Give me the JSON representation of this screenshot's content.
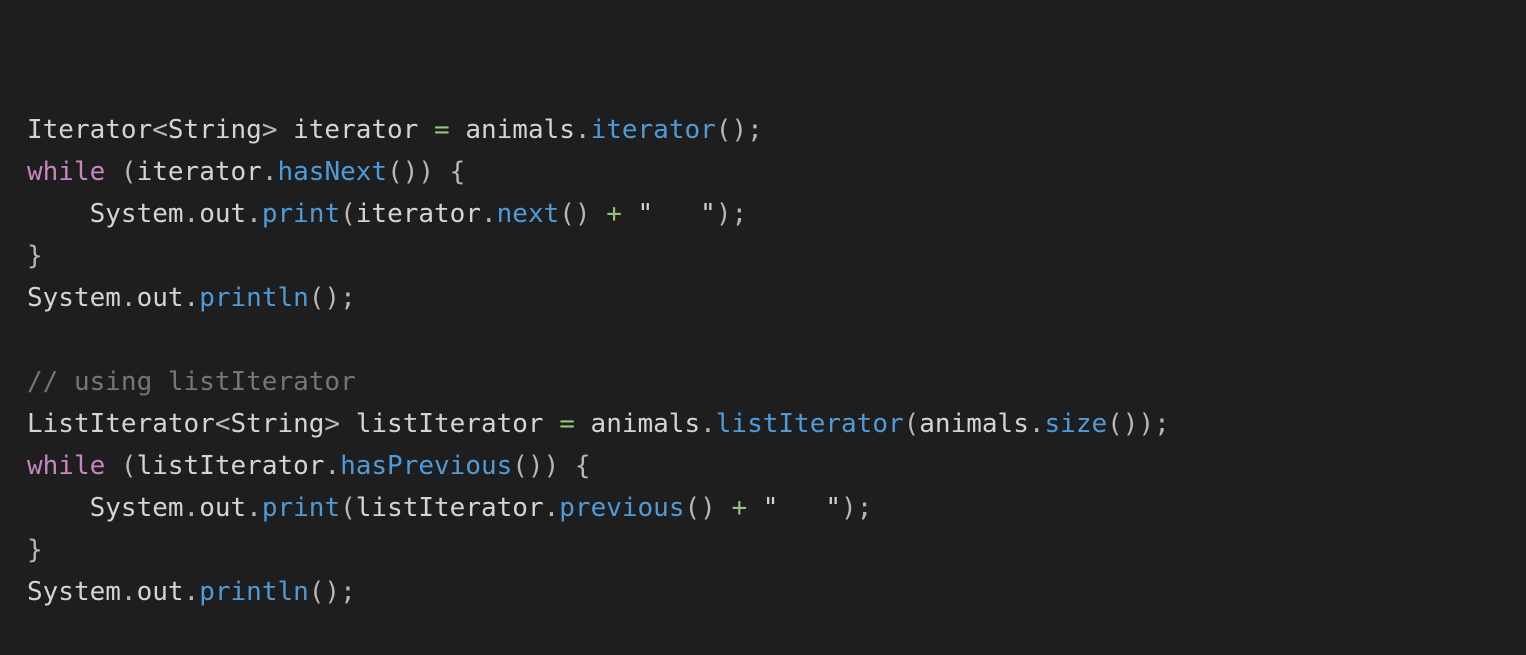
{
  "colors": {
    "background": "#1e1e1e",
    "text": "#d4d4d4",
    "keyword": "#c586c0",
    "function": "#4d9bd8",
    "operator": "#98c379",
    "comment": "#767676"
  },
  "code": {
    "lines": [
      {
        "tokens": [
          {
            "text": "Iterator",
            "type": "plain"
          },
          {
            "text": "<",
            "type": "punc"
          },
          {
            "text": "String",
            "type": "plain"
          },
          {
            "text": ">",
            "type": "punc"
          },
          {
            "text": " iterator ",
            "type": "plain"
          },
          {
            "text": "=",
            "type": "op"
          },
          {
            "text": " animals",
            "type": "plain"
          },
          {
            "text": ".",
            "type": "punc"
          },
          {
            "text": "iterator",
            "type": "fn"
          },
          {
            "text": "();",
            "type": "punc"
          }
        ]
      },
      {
        "tokens": [
          {
            "text": "while",
            "type": "kw"
          },
          {
            "text": " (",
            "type": "punc"
          },
          {
            "text": "iterator",
            "type": "plain"
          },
          {
            "text": ".",
            "type": "punc"
          },
          {
            "text": "hasNext",
            "type": "fn"
          },
          {
            "text": "()) {",
            "type": "punc"
          }
        ]
      },
      {
        "tokens": [
          {
            "text": "    System",
            "type": "plain"
          },
          {
            "text": ".",
            "type": "punc"
          },
          {
            "text": "out",
            "type": "plain"
          },
          {
            "text": ".",
            "type": "punc"
          },
          {
            "text": "print",
            "type": "fn"
          },
          {
            "text": "(",
            "type": "punc"
          },
          {
            "text": "iterator",
            "type": "plain"
          },
          {
            "text": ".",
            "type": "punc"
          },
          {
            "text": "next",
            "type": "fn"
          },
          {
            "text": "() ",
            "type": "punc"
          },
          {
            "text": "+",
            "type": "op"
          },
          {
            "text": " \"   \"",
            "type": "str"
          },
          {
            "text": ");",
            "type": "punc"
          }
        ]
      },
      {
        "tokens": [
          {
            "text": "}",
            "type": "punc"
          }
        ]
      },
      {
        "tokens": [
          {
            "text": "System",
            "type": "plain"
          },
          {
            "text": ".",
            "type": "punc"
          },
          {
            "text": "out",
            "type": "plain"
          },
          {
            "text": ".",
            "type": "punc"
          },
          {
            "text": "println",
            "type": "fn"
          },
          {
            "text": "();",
            "type": "punc"
          }
        ]
      },
      {
        "tokens": []
      },
      {
        "tokens": [
          {
            "text": "// using listIterator",
            "type": "cm"
          }
        ]
      },
      {
        "tokens": [
          {
            "text": "ListIterator",
            "type": "plain"
          },
          {
            "text": "<",
            "type": "punc"
          },
          {
            "text": "String",
            "type": "plain"
          },
          {
            "text": ">",
            "type": "punc"
          },
          {
            "text": " listIterator ",
            "type": "plain"
          },
          {
            "text": "=",
            "type": "op"
          },
          {
            "text": " animals",
            "type": "plain"
          },
          {
            "text": ".",
            "type": "punc"
          },
          {
            "text": "listIterator",
            "type": "fn"
          },
          {
            "text": "(",
            "type": "punc"
          },
          {
            "text": "animals",
            "type": "plain"
          },
          {
            "text": ".",
            "type": "punc"
          },
          {
            "text": "size",
            "type": "fn"
          },
          {
            "text": "());",
            "type": "punc"
          }
        ]
      },
      {
        "tokens": [
          {
            "text": "while",
            "type": "kw"
          },
          {
            "text": " (",
            "type": "punc"
          },
          {
            "text": "listIterator",
            "type": "plain"
          },
          {
            "text": ".",
            "type": "punc"
          },
          {
            "text": "hasPrevious",
            "type": "fn"
          },
          {
            "text": "()) {",
            "type": "punc"
          }
        ]
      },
      {
        "tokens": [
          {
            "text": "    System",
            "type": "plain"
          },
          {
            "text": ".",
            "type": "punc"
          },
          {
            "text": "out",
            "type": "plain"
          },
          {
            "text": ".",
            "type": "punc"
          },
          {
            "text": "print",
            "type": "fn"
          },
          {
            "text": "(",
            "type": "punc"
          },
          {
            "text": "listIterator",
            "type": "plain"
          },
          {
            "text": ".",
            "type": "punc"
          },
          {
            "text": "previous",
            "type": "fn"
          },
          {
            "text": "() ",
            "type": "punc"
          },
          {
            "text": "+",
            "type": "op"
          },
          {
            "text": " \"   \"",
            "type": "str"
          },
          {
            "text": ");",
            "type": "punc"
          }
        ]
      },
      {
        "tokens": [
          {
            "text": "}",
            "type": "punc"
          }
        ]
      },
      {
        "tokens": [
          {
            "text": "System",
            "type": "plain"
          },
          {
            "text": ".",
            "type": "punc"
          },
          {
            "text": "out",
            "type": "plain"
          },
          {
            "text": ".",
            "type": "punc"
          },
          {
            "text": "println",
            "type": "fn"
          },
          {
            "text": "();",
            "type": "punc"
          }
        ]
      }
    ]
  }
}
